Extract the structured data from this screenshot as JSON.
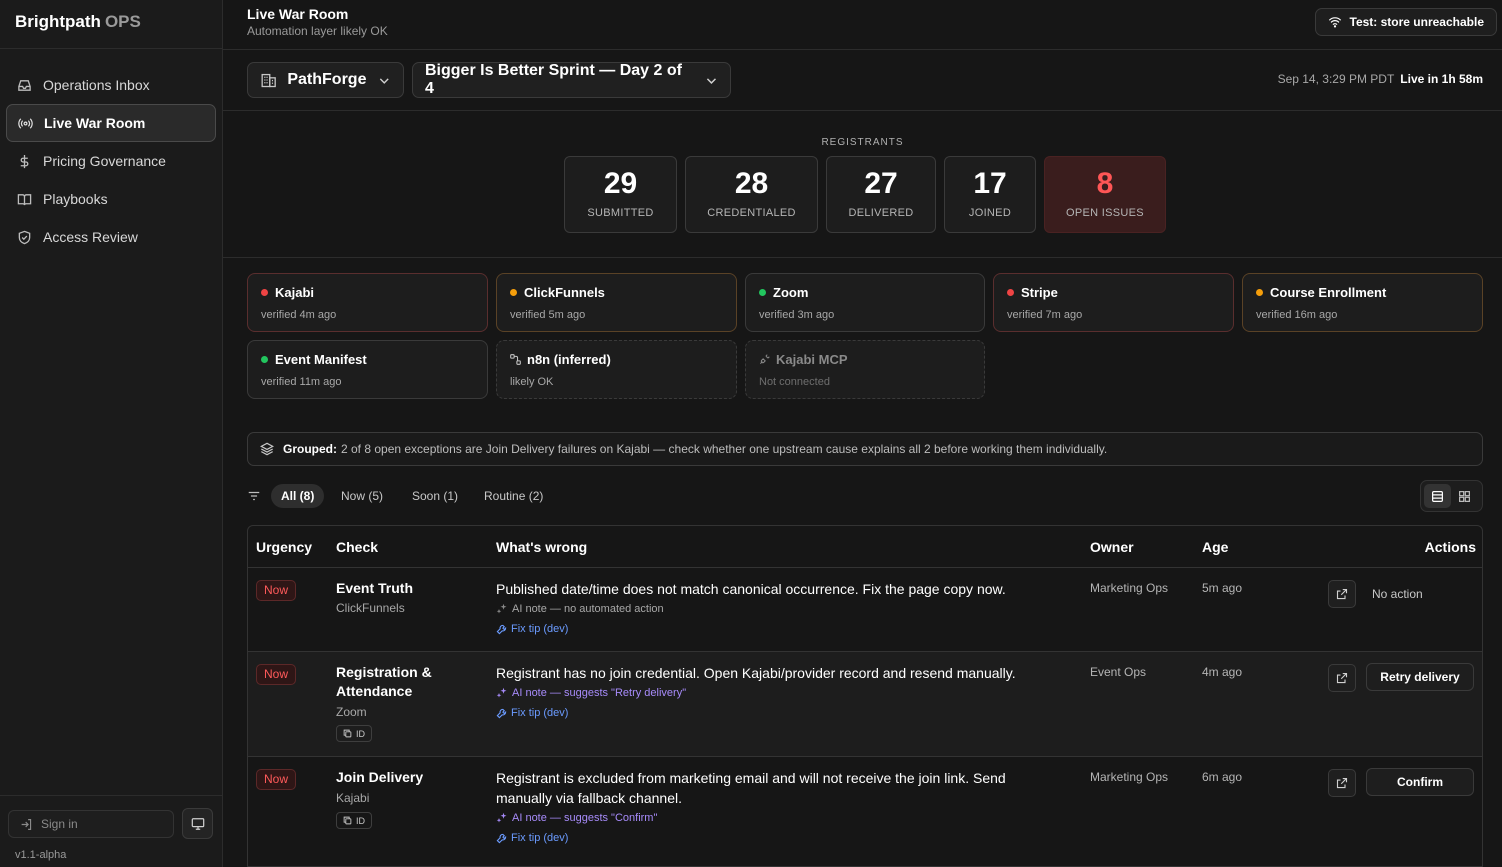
{
  "brand": {
    "name": "Brightpath",
    "suffix": "OPS"
  },
  "sidebar": {
    "items": [
      {
        "label": "Operations Inbox",
        "icon": "inbox-icon"
      },
      {
        "label": "Live War Room",
        "icon": "broadcast-icon",
        "active": true
      },
      {
        "label": "Pricing Governance",
        "icon": "dollar-icon"
      },
      {
        "label": "Playbooks",
        "icon": "book-icon"
      },
      {
        "label": "Access Review",
        "icon": "shield-icon"
      }
    ],
    "signin_label": "Sign in",
    "version": "v1.1-alpha"
  },
  "header": {
    "title": "Live War Room",
    "subtitle": "Automation layer likely OK",
    "store_button": "Test: store unreachable"
  },
  "selectors": {
    "org": "PathForge",
    "event": "Bigger Is Better Sprint — Day 2 of 4",
    "timestamp": "Sep 14, 3:29 PM PDT",
    "live_status": "Live in 1h 58m"
  },
  "registrants": {
    "label": "REGISTRANTS",
    "stats": [
      {
        "value": "29",
        "label": "SUBMITTED"
      },
      {
        "value": "28",
        "label": "CREDENTIALED"
      },
      {
        "value": "27",
        "label": "DELIVERED"
      },
      {
        "value": "17",
        "label": "JOINED"
      },
      {
        "value": "8",
        "label": "OPEN ISSUES"
      }
    ]
  },
  "integrations": [
    {
      "name": "Kajabi",
      "status": "verified 4m ago",
      "dot_color": "#ef4444"
    },
    {
      "name": "ClickFunnels",
      "status": "verified 5m ago",
      "dot_color": "#f59e0b"
    },
    {
      "name": "Zoom",
      "status": "verified 3m ago",
      "dot_color": "#22c55e"
    },
    {
      "name": "Stripe",
      "status": "verified 7m ago",
      "dot_color": "#ef4444"
    },
    {
      "name": "Course Enrollment",
      "status": "verified 16m ago",
      "dot_color": "#f59e0b"
    },
    {
      "name": "Event Manifest",
      "status": "verified 11m ago",
      "dot_color": "#22c55e"
    },
    {
      "name": "n8n (inferred)",
      "status": "likely OK"
    },
    {
      "name": "Kajabi MCP",
      "status": "Not connected"
    }
  ],
  "grouped": {
    "label": "Grouped:",
    "text": "2 of 8 open exceptions are Join Delivery failures on Kajabi — check whether one upstream cause explains all 2 before working them individually."
  },
  "filters": [
    "All (8)",
    "Now (5)",
    "Soon (1)",
    "Routine (2)"
  ],
  "table": {
    "headers": [
      "Urgency",
      "Check",
      "What's wrong",
      "Owner",
      "Age",
      "Actions"
    ],
    "rows": [
      {
        "urgency": "Now",
        "check": "Event Truth",
        "source": "ClickFunnels",
        "wrong": "Published date/time does not match canonical occurrence. Fix the page copy now.",
        "ai_note": "AI note — no automated action",
        "fix_tip": "Fix tip (dev)",
        "owner": "Marketing Ops",
        "age": "5m ago",
        "action": "No action"
      },
      {
        "urgency": "Now",
        "check": "Registration & Attendance",
        "source": "Zoom",
        "id_label": "ID",
        "wrong": "Registrant has no join credential. Open Kajabi/provider record and resend manually.",
        "ai_note": "AI note — suggests \"Retry delivery\"",
        "fix_tip": "Fix tip (dev)",
        "owner": "Event Ops",
        "age": "4m ago",
        "action": "Retry delivery"
      },
      {
        "urgency": "Now",
        "check": "Join Delivery",
        "source": "Kajabi",
        "id_label": "ID",
        "wrong": "Registrant is excluded from marketing email and will not receive the join link. Send manually via fallback channel.",
        "ai_note": "AI note — suggests \"Confirm\"",
        "fix_tip": "Fix tip (dev)",
        "owner": "Marketing Ops",
        "age": "6m ago",
        "action": "Confirm"
      }
    ]
  },
  "colors": {
    "accent_red": "#ff5656",
    "purple_note": "#a78bfa",
    "link_blue": "#6b9bff"
  }
}
